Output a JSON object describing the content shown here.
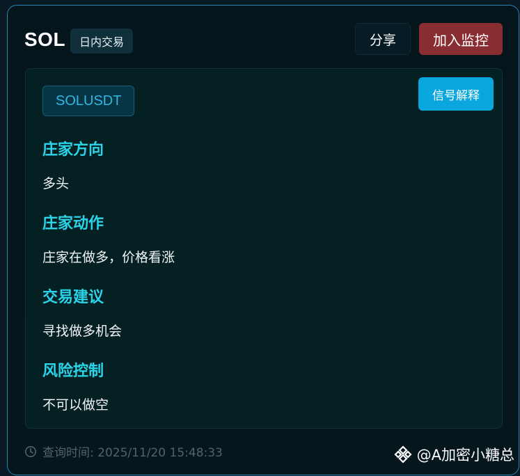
{
  "header": {
    "symbol": "SOL",
    "mode_badge": "日内交易",
    "share_label": "分享",
    "monitor_label": "加入监控"
  },
  "panel": {
    "pair_tag": "SOLUSDT",
    "explain_label": "信号解释",
    "sections": [
      {
        "title": "庄家方向",
        "body": "多头"
      },
      {
        "title": "庄家动作",
        "body": "庄家在做多，价格看涨"
      },
      {
        "title": "交易建议",
        "body": "寻找做多机会"
      },
      {
        "title": "风险控制",
        "body": "不可以做空"
      }
    ]
  },
  "footer": {
    "query_time": "查询时间: 2025/11/20 15:48:33"
  },
  "watermark": {
    "text": "@A加密小糖总",
    "icon": "binance-diamond-icon"
  },
  "colors": {
    "accent_cyan": "#2ad4ea",
    "monitor_red": "#8a2d33",
    "explain_blue": "#0aa6de",
    "border_blue": "#1f86b8"
  }
}
